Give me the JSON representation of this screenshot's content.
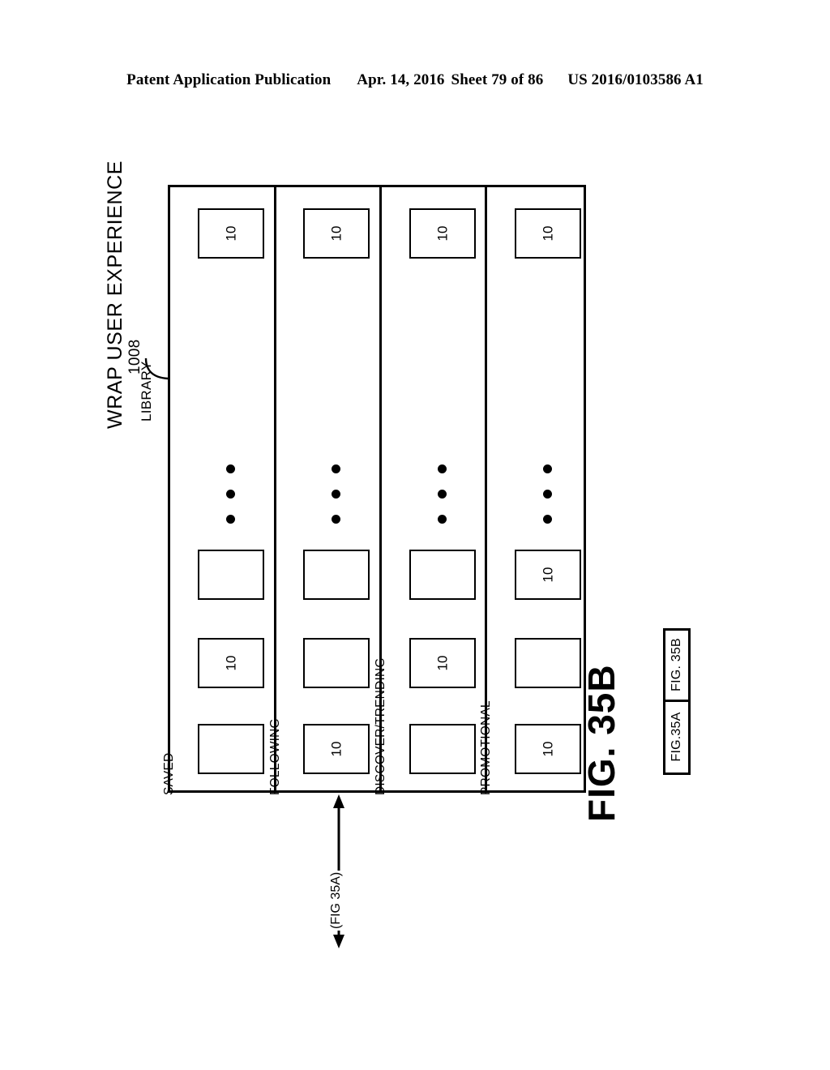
{
  "header": {
    "publication": "Patent Application Publication",
    "date": "Apr. 14, 2016",
    "sheet": "Sheet 79 of 86",
    "patent_number": "US 2016/0103586 A1"
  },
  "figure": {
    "caption": "FIG. 35B",
    "title_main": "WRAP USER EXPERIENCE",
    "title_sub": "LIBRARY",
    "reference_numeral": "1008",
    "continuation_label": "(FIG 35A)",
    "card_number": "10",
    "ellipsis_glyph": "dots-vertical-icon",
    "key": {
      "top_label": "FIG. 35B",
      "bottom_label": "FIG.35A"
    },
    "rows": [
      {
        "label": "SAVED",
        "cards": [
          {
            "num": "",
            "labeled": false
          },
          {
            "num": "10",
            "labeled": true
          },
          {
            "num": "",
            "labeled": false
          },
          {
            "num": "10",
            "labeled": true
          }
        ]
      },
      {
        "label": "FOLLOWING",
        "cards": [
          {
            "num": "10",
            "labeled": true
          },
          {
            "num": "",
            "labeled": false
          },
          {
            "num": "",
            "labeled": false
          },
          {
            "num": "10",
            "labeled": true
          }
        ]
      },
      {
        "label": "DISCOVER/TRENDING",
        "cards": [
          {
            "num": "",
            "labeled": false
          },
          {
            "num": "10",
            "labeled": true
          },
          {
            "num": "",
            "labeled": false
          },
          {
            "num": "10",
            "labeled": true
          }
        ]
      },
      {
        "label": "PROMOTIONAL",
        "cards": [
          {
            "num": "10",
            "labeled": true
          },
          {
            "num": "",
            "labeled": false
          },
          {
            "num": "10",
            "labeled": true
          },
          {
            "num": "10",
            "labeled": true
          }
        ]
      }
    ]
  },
  "colors": {
    "ink": "#000000",
    "paper": "#ffffff"
  }
}
